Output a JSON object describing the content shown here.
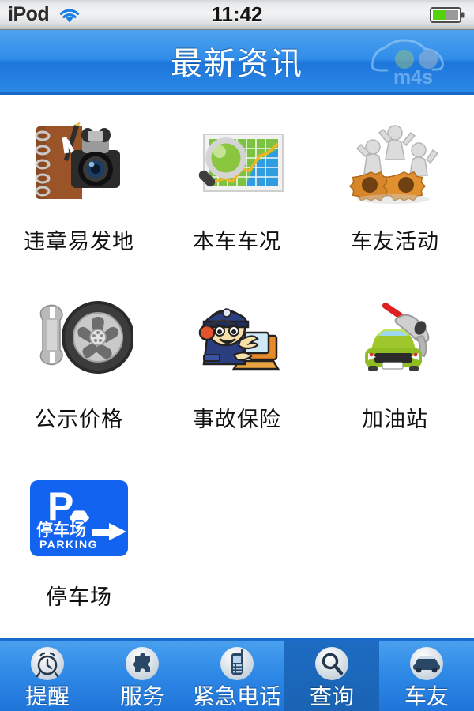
{
  "status_bar": {
    "carrier": "iPod",
    "wifi_icon": "wifi-icon",
    "time": "11:42",
    "battery_icon": "battery-icon",
    "battery_level_percent": 50
  },
  "nav_bar": {
    "title": "最新资讯",
    "watermark_text": "m4s",
    "watermark_icon": "car-cloud-logo-icon",
    "background_color": "#2f8ce9"
  },
  "grid": {
    "items": [
      {
        "label": "违章易发地",
        "icon": "notebook-camera-icon"
      },
      {
        "label": "本车车况",
        "icon": "chart-magnifier-icon"
      },
      {
        "label": "车友活动",
        "icon": "people-gears-icon"
      },
      {
        "label": "公示价格",
        "icon": "wrench-wheel-icon"
      },
      {
        "label": "事故保险",
        "icon": "police-operator-icon"
      },
      {
        "label": "加油站",
        "icon": "car-fuel-nozzle-icon"
      },
      {
        "label": "停车场",
        "icon": "parking-sign-icon"
      }
    ]
  },
  "parking_sign": {
    "letter": "P",
    "chinese": "停车场",
    "english": "PARKING",
    "background_color": "#1163f0"
  },
  "tab_bar": {
    "selected_index": 3,
    "tabs": [
      {
        "label": "提醒",
        "icon": "alarm-clock-icon"
      },
      {
        "label": "服务",
        "icon": "puzzle-piece-icon"
      },
      {
        "label": "紧急电话",
        "icon": "mobile-phone-icon"
      },
      {
        "label": "查询",
        "icon": "search-magnifier-icon"
      },
      {
        "label": "车友",
        "icon": "car-icon"
      }
    ]
  }
}
